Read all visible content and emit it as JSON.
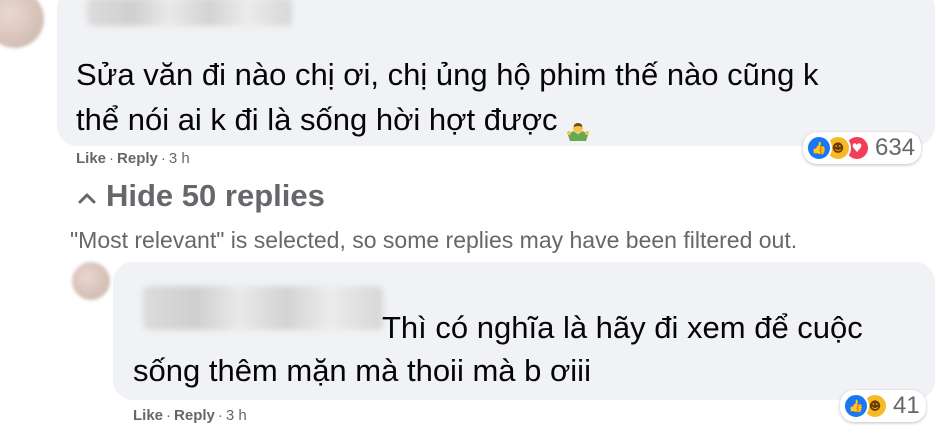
{
  "comment": {
    "text_line1": "Sửa văn đi nào chị ơi, chị ủng hộ phim thế nào cũng k",
    "text_line2": "thể nói ai k đi là sống hời hợt được",
    "emoji": "person-shrugging",
    "like_label": "Like",
    "reply_label": "Reply",
    "time": "3 h",
    "reaction_count": "634"
  },
  "replies_toggle": {
    "chevron": "^",
    "label": "Hide 50 replies"
  },
  "filter_note": "\"Most relevant\" is selected, so some replies may have been filtered out.",
  "reply": {
    "text_line1": "Thì có nghĩa là hãy đi xem để cuộc",
    "text_line2": "sống thêm mặn mà thoii mà b ơiii",
    "like_label": "Like",
    "reply_label": "Reply",
    "time": "3 h",
    "reaction_count": "41"
  },
  "colors": {
    "bubble": "#f0f2f5",
    "meta_text": "#65676b",
    "like_blue": "#1877f2",
    "haha_yellow": "#f7b928",
    "love_red": "#f33e58"
  }
}
